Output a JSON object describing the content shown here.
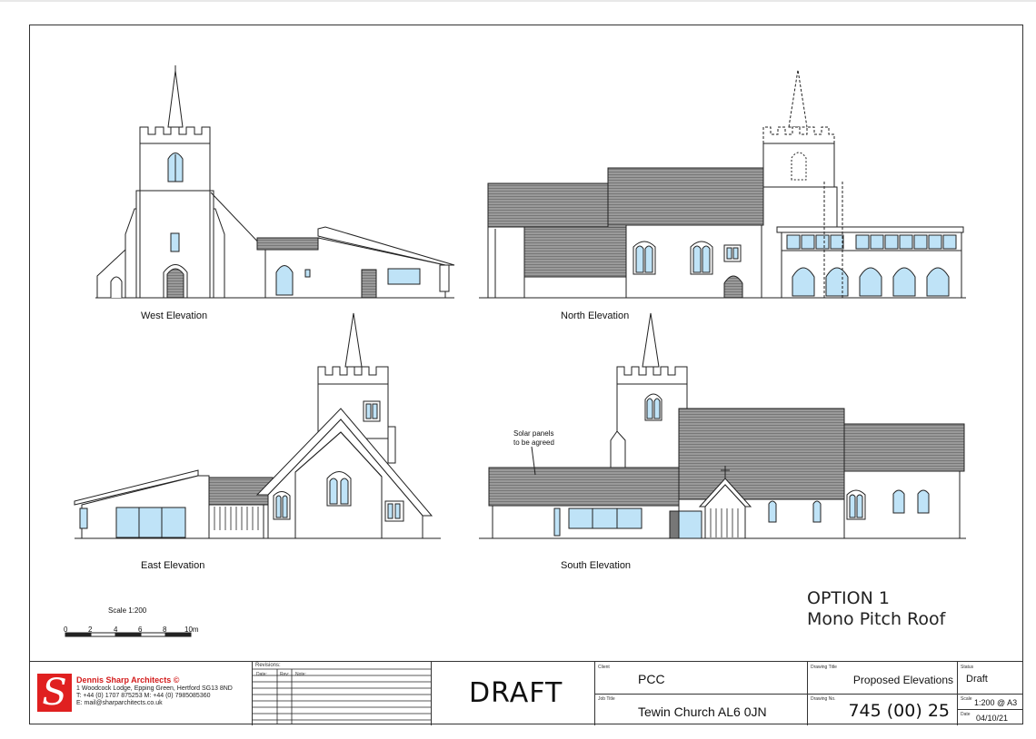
{
  "elevations": {
    "west": "West Elevation",
    "north": "North Elevation",
    "east": "East Elevation",
    "south": "South Elevation"
  },
  "note": {
    "line1": "Solar panels",
    "line2": "to be agreed"
  },
  "option": {
    "title": "OPTION 1",
    "subtitle": "Mono Pitch Roof"
  },
  "scale_bar": {
    "title": "Scale 1:200",
    "ticks": [
      "0",
      "2",
      "4",
      "6",
      "8",
      "10m"
    ]
  },
  "title_block": {
    "firm": "Dennis Sharp Architects ©",
    "address1": "1 Woodcock Lodge, Epping Green, Hertford SG13 8ND",
    "address2": "T: +44 (0) 1707 875253  M: +44 (0) 7985085360",
    "address3": "E: mail@sharparchitects.co.uk",
    "revisions_label": "Revisions:",
    "rev_headers": [
      "Date:",
      "Rev:",
      "Note:"
    ],
    "stamp": "DRAFT",
    "client_label": "Client",
    "client": "PCC",
    "job_label": "Job Title",
    "job": "Tewin Church AL6 0JN",
    "drawing_title_label": "Drawing Title",
    "drawing_title": "Proposed Elevations",
    "drawing_no_label": "Drawing No.",
    "drawing_no": "745 (00) 25",
    "status_label": "Status",
    "status": "Draft",
    "scale_label": "Scale",
    "scale": "1:200 @ A3",
    "date_label": "Date",
    "date": "04/10/21"
  }
}
